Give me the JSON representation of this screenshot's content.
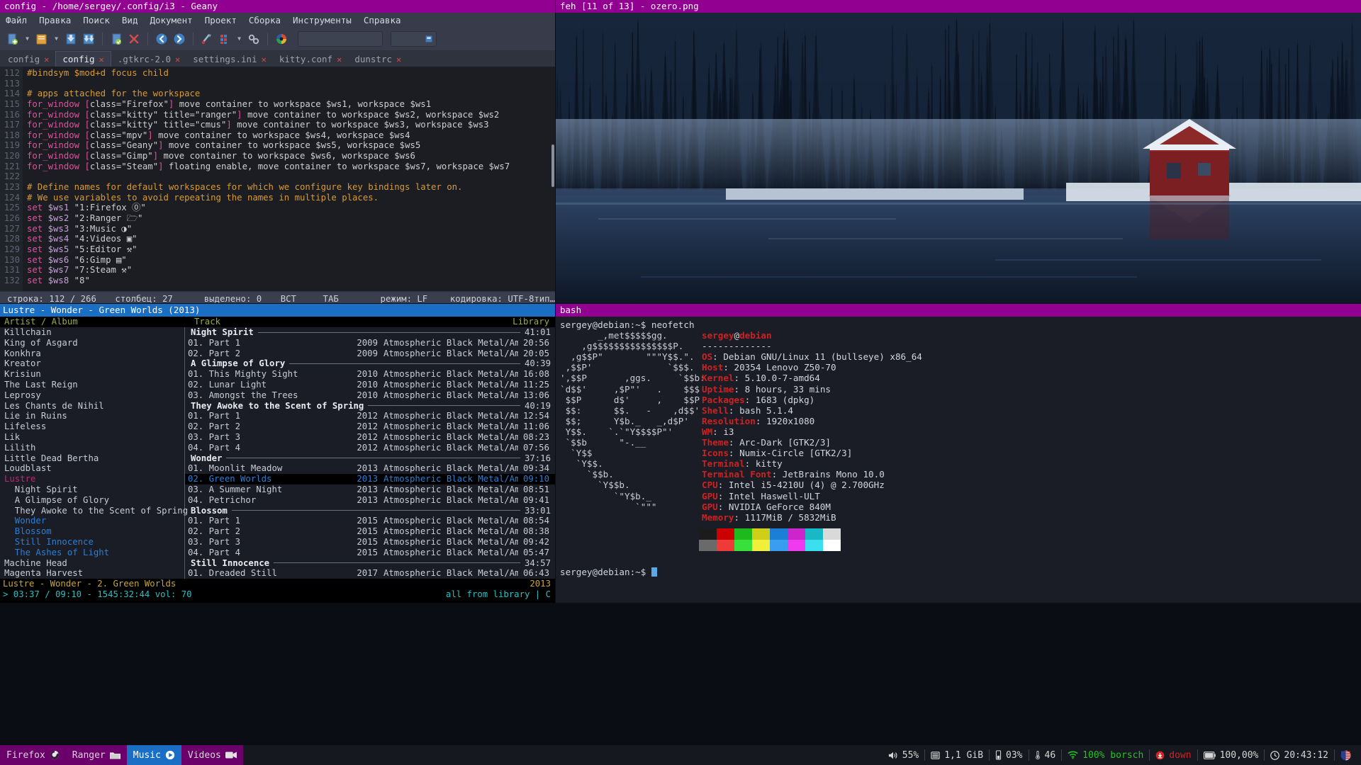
{
  "geany": {
    "window_title": "config - /home/sergey/.config/i3 - Geany",
    "menu": [
      "Файл",
      "Правка",
      "Поиск",
      "Вид",
      "Документ",
      "Проект",
      "Сборка",
      "Инструменты",
      "Справка"
    ],
    "tabs": [
      {
        "label": "config",
        "active": false
      },
      {
        "label": "config",
        "active": true
      },
      {
        "label": ".gtkrc-2.0",
        "active": false
      },
      {
        "label": "settings.ini",
        "active": false
      },
      {
        "label": "kitty.conf",
        "active": false
      },
      {
        "label": "dunstrc",
        "active": false
      }
    ],
    "first_line_number": 112,
    "lines": [
      {
        "n": 112,
        "text": "#bindsym $mod+d focus child",
        "kind": "comment"
      },
      {
        "n": 113,
        "text": "",
        "kind": "plain"
      },
      {
        "n": 114,
        "text": "# apps attached for the workspace",
        "kind": "comment"
      },
      {
        "n": 115,
        "text": "for_window [class=\"Firefox\"] move container to workspace $ws1, workspace $ws1",
        "kind": "rule"
      },
      {
        "n": 116,
        "text": "for_window [class=\"kitty\" title=\"ranger\"] move container to workspace $ws2, workspace $ws2",
        "kind": "rule"
      },
      {
        "n": 117,
        "text": "for_window [class=\"kitty\" title=\"cmus\"] move container to workspace $ws3, workspace $ws3",
        "kind": "rule"
      },
      {
        "n": 118,
        "text": "for_window [class=\"mpv\"] move container to workspace $ws4, workspace $ws4",
        "kind": "rule"
      },
      {
        "n": 119,
        "text": "for_window [class=\"Geany\"] move container to workspace $ws5, workspace $ws5",
        "kind": "rule"
      },
      {
        "n": 120,
        "text": "for_window [class=\"Gimp\"] move container to workspace $ws6, workspace $ws6",
        "kind": "rule"
      },
      {
        "n": 121,
        "text": "for_window [class=\"Steam\"] floating enable, move container to workspace $ws7, workspace $ws7",
        "kind": "rule"
      },
      {
        "n": 122,
        "text": "",
        "kind": "plain"
      },
      {
        "n": 123,
        "text": "# Define names for default workspaces for which we configure key bindings later on.",
        "kind": "comment"
      },
      {
        "n": 124,
        "text": "# We use variables to avoid repeating the names in multiple places.",
        "kind": "comment"
      },
      {
        "n": 125,
        "text": "set $ws1 \"1:Firefox ⓪\"",
        "kind": "set"
      },
      {
        "n": 126,
        "text": "set $ws2 \"2:Ranger 🗁\"",
        "kind": "set"
      },
      {
        "n": 127,
        "text": "set $ws3 \"3:Music ◑\"",
        "kind": "set"
      },
      {
        "n": 128,
        "text": "set $ws4 \"4:Videos ▣\"",
        "kind": "set"
      },
      {
        "n": 129,
        "text": "set $ws5 \"5:Editor ⚒\"",
        "kind": "set"
      },
      {
        "n": 130,
        "text": "set $ws6 \"6:Gimp ▤\"",
        "kind": "set"
      },
      {
        "n": 131,
        "text": "set $ws7 \"7:Steam ⚒\"",
        "kind": "set"
      },
      {
        "n": 132,
        "text": "set $ws8 \"8\"",
        "kind": "set"
      }
    ],
    "status": {
      "line": "строка: 112 / 266",
      "column": "столбец: 27",
      "selection": "выделено: 0",
      "insert_mode": "ВСТ",
      "tab_mode": "ТАБ",
      "eol_mode": "режим: LF",
      "encoding": "кодировка: UTF-8",
      "filetype": "тип…"
    }
  },
  "feh": {
    "window_title": "feh [11 of 13] - ozero.png"
  },
  "cmus": {
    "window_title": "Lustre - Wonder - Green Worlds (2013)",
    "header": {
      "left": "Artist / Album",
      "track": "Track",
      "right": "Library"
    },
    "artists": [
      {
        "label": "Killchain",
        "style": "normal"
      },
      {
        "label": "King of Asgard",
        "style": "normal"
      },
      {
        "label": "Konkhra",
        "style": "normal"
      },
      {
        "label": "Kreator",
        "style": "normal"
      },
      {
        "label": "Krisiun",
        "style": "normal"
      },
      {
        "label": "The Last Reign",
        "style": "normal"
      },
      {
        "label": "Leprosy",
        "style": "normal"
      },
      {
        "label": "Les Chants de Nihil",
        "style": "normal"
      },
      {
        "label": "Lie in Ruins",
        "style": "normal"
      },
      {
        "label": "Lifeless",
        "style": "normal"
      },
      {
        "label": "Lik",
        "style": "normal"
      },
      {
        "label": "Lilith",
        "style": "normal"
      },
      {
        "label": "Little Dead Bertha",
        "style": "normal"
      },
      {
        "label": "Loudblast",
        "style": "normal"
      },
      {
        "label": "Lustre",
        "style": "current"
      },
      {
        "label": "  Night Spirit",
        "style": "album"
      },
      {
        "label": "  A Glimpse of Glory",
        "style": "album"
      },
      {
        "label": "  They Awoke to the Scent of Spring",
        "style": "album"
      },
      {
        "label": "  Wonder",
        "style": "album-sel"
      },
      {
        "label": "  Blossom",
        "style": "album-sel"
      },
      {
        "label": "  Still Innocence",
        "style": "album-sel"
      },
      {
        "label": "  The Ashes of Light",
        "style": "album-sel"
      },
      {
        "label": "Machine Head",
        "style": "normal"
      },
      {
        "label": "Magenta Harvest",
        "style": "normal"
      }
    ],
    "albums": [
      {
        "name": "Night Spirit",
        "duration": "41:01",
        "tracks": [
          {
            "t": "01. Part 1",
            "y": "2009",
            "g": "Atmospheric Black Metal/Ambient",
            "d": "20:56",
            "sel": false
          },
          {
            "t": "02. Part 2",
            "y": "2009",
            "g": "Atmospheric Black Metal/Ambient",
            "d": "20:05",
            "sel": false
          }
        ]
      },
      {
        "name": "A Glimpse of Glory",
        "duration": "40:39",
        "tracks": [
          {
            "t": "01. This Mighty Sight",
            "y": "2010",
            "g": "Atmospheric Black Metal/Ambient",
            "d": "16:08",
            "sel": false
          },
          {
            "t": "02. Lunar Light",
            "y": "2010",
            "g": "Atmospheric Black Metal/Ambient",
            "d": "11:25",
            "sel": false
          },
          {
            "t": "03. Amongst the Trees",
            "y": "2010",
            "g": "Atmospheric Black Metal/Ambient",
            "d": "13:06",
            "sel": false
          }
        ]
      },
      {
        "name": "They Awoke to the Scent of Spring",
        "duration": "40:19",
        "tracks": [
          {
            "t": "01. Part 1",
            "y": "2012",
            "g": "Atmospheric Black Metal/Ambient",
            "d": "12:54",
            "sel": false
          },
          {
            "t": "02. Part 2",
            "y": "2012",
            "g": "Atmospheric Black Metal/Ambient",
            "d": "11:06",
            "sel": false
          },
          {
            "t": "03. Part 3",
            "y": "2012",
            "g": "Atmospheric Black Metal/Ambient",
            "d": "08:23",
            "sel": false
          },
          {
            "t": "04. Part 4",
            "y": "2012",
            "g": "Atmospheric Black Metal/Ambient",
            "d": "07:56",
            "sel": false
          }
        ]
      },
      {
        "name": "Wonder",
        "duration": "37:16",
        "tracks": [
          {
            "t": "01. Moonlit Meadow",
            "y": "2013",
            "g": "Atmospheric Black Metal/Ambient",
            "d": "09:34",
            "sel": false
          },
          {
            "t": "02. Green Worlds",
            "y": "2013",
            "g": "Atmospheric Black Metal/Ambient",
            "d": "09:10",
            "sel": true
          },
          {
            "t": "03. A Summer Night",
            "y": "2013",
            "g": "Atmospheric Black Metal/Ambient",
            "d": "08:51",
            "sel": false
          },
          {
            "t": "04. Petrichor",
            "y": "2013",
            "g": "Atmospheric Black Metal/Ambient",
            "d": "09:41",
            "sel": false
          }
        ]
      },
      {
        "name": "Blossom",
        "duration": "33:01",
        "tracks": [
          {
            "t": "01. Part 1",
            "y": "2015",
            "g": "Atmospheric Black Metal/Ambient",
            "d": "08:54",
            "sel": false
          },
          {
            "t": "02. Part 2",
            "y": "2015",
            "g": "Atmospheric Black Metal/Ambient",
            "d": "08:38",
            "sel": false
          },
          {
            "t": "03. Part 3",
            "y": "2015",
            "g": "Atmospheric Black Metal/Ambient",
            "d": "09:42",
            "sel": false
          },
          {
            "t": "04. Part 4",
            "y": "2015",
            "g": "Atmospheric Black Metal/Ambient",
            "d": "05:47",
            "sel": false
          }
        ]
      },
      {
        "name": "Still Innocence",
        "duration": "34:57",
        "tracks": [
          {
            "t": "01. Dreaded Still",
            "y": "2017",
            "g": "Atmospheric Black Metal/Ambient",
            "d": "06:43",
            "sel": false
          }
        ]
      }
    ],
    "now_playing": "Lustre - Wonder -  2. Green Worlds",
    "now_playing_year": "2013",
    "progress": "> 03:37 / 09:10 - 1545:32:44 vol: 70",
    "mode_right": "all from library  |  C"
  },
  "kitty": {
    "window_title": "bash",
    "prompt_line": "sergey@debian:~$ neofetch",
    "prompt_tail": "sergey@debian:~$ ",
    "ascii": [
      "       _,met$$$$$gg.",
      "    ,g$$$$$$$$$$$$$$$P.",
      "  ,g$$P\"        \"\"\"Y$$.\".",
      " ,$$P'              `$$$.",
      "',$$P       ,ggs.     `$$b:",
      "`d$$'     ,$P\"'   .    $$$",
      " $$P      d$'     ,    $$P",
      " $$:      $$.   -    ,d$$'",
      " $$;      Y$b._   _,d$P'",
      " Y$$.    `.`\"Y$$$$P\"'",
      " `$$b      \"-.__",
      "  `Y$$",
      "   `Y$$.",
      "     `$$b.",
      "       `Y$$b.",
      "          `\"Y$b._",
      "              `\"\"\""
    ],
    "user_host": {
      "user": "sergey",
      "sep": "@",
      "host": "debian"
    },
    "rule": "-------------",
    "info": [
      {
        "key": "OS",
        "value": "Debian GNU/Linux 11 (bullseye) x86_64"
      },
      {
        "key": "Host",
        "value": "20354 Lenovo Z50-70"
      },
      {
        "key": "Kernel",
        "value": "5.10.0-7-amd64"
      },
      {
        "key": "Uptime",
        "value": "8 hours, 33 mins"
      },
      {
        "key": "Packages",
        "value": "1683 (dpkg)"
      },
      {
        "key": "Shell",
        "value": "bash 5.1.4"
      },
      {
        "key": "Resolution",
        "value": "1920x1080"
      },
      {
        "key": "WM",
        "value": "i3"
      },
      {
        "key": "Theme",
        "value": "Arc-Dark [GTK2/3]"
      },
      {
        "key": "Icons",
        "value": "Numix-Circle [GTK2/3]"
      },
      {
        "key": "Terminal",
        "value": "kitty"
      },
      {
        "key": "Terminal Font",
        "value": "JetBrains Mono 10.0"
      },
      {
        "key": "CPU",
        "value": "Intel i5-4210U (4) @ 2.700GHz"
      },
      {
        "key": "GPU",
        "value": "Intel Haswell-ULT"
      },
      {
        "key": "GPU",
        "value": "NVIDIA GeForce 840M"
      },
      {
        "key": "Memory",
        "value": "1117MiB / 5832MiB"
      }
    ],
    "swatch_row1": [
      "#1c1c1c",
      "#cc0000",
      "#1db91d",
      "#cfcf18",
      "#1c7fd6",
      "#cc25cc",
      "#18b8c4",
      "#d9d9d9"
    ],
    "swatch_row2": [
      "#6a6a6a",
      "#ef3a3a",
      "#3ae03a",
      "#f0f03a",
      "#3a9ef0",
      "#ef3aef",
      "#3ae0ef",
      "#ffffff"
    ]
  },
  "i3bar": {
    "workspaces": [
      {
        "label": "Firefox",
        "icon": "firefox-icon",
        "active": false
      },
      {
        "label": "Ranger",
        "icon": "folder-icon",
        "active": false
      },
      {
        "label": "Music",
        "icon": "disc-icon",
        "active": true
      },
      {
        "label": "Videos",
        "icon": "video-camera-icon",
        "active": false
      }
    ],
    "status": [
      {
        "icon": "volume-icon",
        "text": "55%",
        "color": "#d6d6d6"
      },
      {
        "icon": "memory-icon",
        "text": "1,1 GiB",
        "color": "#d6d6d6"
      },
      {
        "icon": "cpu-icon",
        "text": "03%",
        "color": "#d6d6d6"
      },
      {
        "icon": "thermometer-icon",
        "text": "46",
        "color": "#d6d6d6"
      },
      {
        "icon": "wifi-icon",
        "text": "100% borsch",
        "color": "#25c225"
      },
      {
        "icon": "network-down-icon",
        "text": "down",
        "color": "#d62222"
      },
      {
        "icon": "battery-icon",
        "text": "100,00%",
        "color": "#d6d6d6"
      },
      {
        "icon": "clock-icon",
        "text": "20:43:12",
        "color": "#d6d6d6"
      },
      {
        "icon": "flag-icon",
        "text": "",
        "color": "#d6d6d6"
      }
    ]
  }
}
